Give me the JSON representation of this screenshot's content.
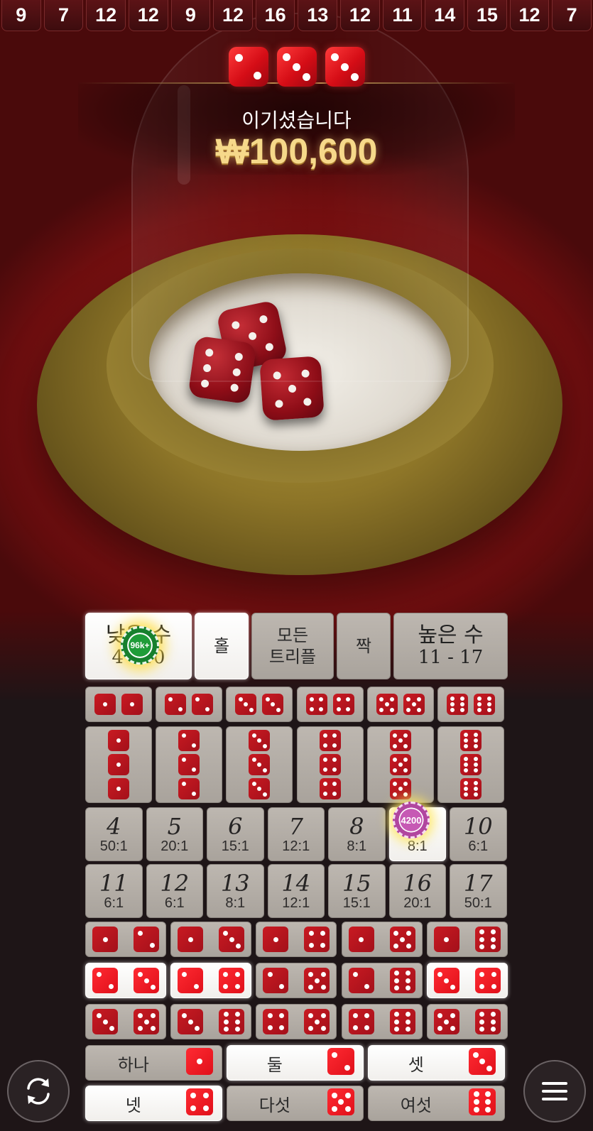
{
  "history": [
    9,
    7,
    12,
    12,
    9,
    12,
    16,
    13,
    12,
    11,
    14,
    15,
    12,
    7
  ],
  "result": {
    "dice": [
      2,
      3,
      3
    ],
    "win_label": "이기셨습니다",
    "win_amount": "₩100,600"
  },
  "board": {
    "big_small": {
      "small": {
        "label": "낮은 수",
        "range": "4 - 10"
      },
      "odd": {
        "label": "홀"
      },
      "any_triple": {
        "label_line1": "모든",
        "label_line2": "트리플"
      },
      "even": {
        "label": "짝"
      },
      "big": {
        "label": "높은 수",
        "range": "11 - 17"
      }
    },
    "totals_row1": [
      {
        "num": "4",
        "pay": "50:1"
      },
      {
        "num": "5",
        "pay": "20:1"
      },
      {
        "num": "6",
        "pay": "15:1"
      },
      {
        "num": "7",
        "pay": "12:1"
      },
      {
        "num": "8",
        "pay": "8:1"
      },
      {
        "num": "9",
        "pay": "8:1"
      },
      {
        "num": "10",
        "pay": "6:1"
      }
    ],
    "totals_row2": [
      {
        "num": "11",
        "pay": "6:1"
      },
      {
        "num": "12",
        "pay": "6:1"
      },
      {
        "num": "13",
        "pay": "8:1"
      },
      {
        "num": "14",
        "pay": "12:1"
      },
      {
        "num": "15",
        "pay": "15:1"
      },
      {
        "num": "16",
        "pay": "20:1"
      },
      {
        "num": "17",
        "pay": "50:1"
      }
    ],
    "singles": [
      {
        "label": "하나",
        "face": 1
      },
      {
        "label": "둘",
        "face": 2
      },
      {
        "label": "셋",
        "face": 3
      },
      {
        "label": "넷",
        "face": 4
      },
      {
        "label": "다섯",
        "face": 5
      },
      {
        "label": "여섯",
        "face": 6
      }
    ]
  },
  "chips": {
    "small_bet": "96k+",
    "total_nine_bet": "4200"
  },
  "colors": {
    "felt": "#8e1414",
    "board_cell": "#b3ada6",
    "winning_cell": "#ffffff",
    "die_red": "#e0101a",
    "win_gold": "#f6d98a"
  },
  "icons": {
    "repeat": "repeat-icon",
    "menu": "hamburger-menu-icon"
  }
}
